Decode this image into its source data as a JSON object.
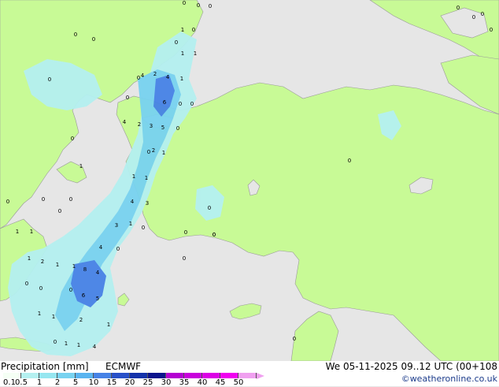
{
  "footer": {
    "product_label": "Precipitation [mm]",
    "model_label": "ECMWF",
    "datetime_label": "We 05-11-2025 09..12 UTC (00+108",
    "copyright": "©weatheronline.co.uk"
  },
  "legend": {
    "ticks": [
      "0.1",
      "0.5",
      "1",
      "2",
      "5",
      "10",
      "15",
      "20",
      "25",
      "30",
      "35",
      "40",
      "45",
      "50"
    ],
    "colors": [
      "#f5fff5",
      "#b4f0f0",
      "#96e6f0",
      "#78d2f0",
      "#5ab4f0",
      "#4682e6",
      "#2850c8",
      "#1432aa",
      "#0a148c",
      "#b400d2",
      "#c800dc",
      "#dc00e6",
      "#f000f0",
      "#f0a0f0"
    ]
  },
  "colors": {
    "land": "#c8fa96",
    "sea": "#e6e6e6",
    "rain_light": "#b4f0f0",
    "rain_moderate": "#78d2f0",
    "rain_heavy": "#4682e6"
  },
  "rain_labels": [
    "0",
    "0",
    "0",
    "0",
    "0",
    "0",
    "0",
    "0",
    "1",
    "0",
    "0",
    "0",
    "1",
    "1",
    "4",
    "2",
    "0",
    "4",
    "1",
    "6",
    "0",
    "0",
    "4",
    "2",
    "3",
    "5",
    "0",
    "0",
    "2",
    "1",
    "0",
    "1",
    "1",
    "0",
    "4",
    "3",
    "1",
    "0",
    "3",
    "1",
    "0",
    "0",
    "0",
    "0",
    "0",
    "4",
    "0",
    "1",
    "1",
    "1",
    "2",
    "1",
    "1",
    "8",
    "4",
    "0",
    "6",
    "5",
    "0",
    "0",
    "1",
    "1",
    "2",
    "1",
    "0",
    "1",
    "1",
    "4",
    "0",
    "0",
    "0",
    "0",
    "0",
    "0",
    "0"
  ]
}
